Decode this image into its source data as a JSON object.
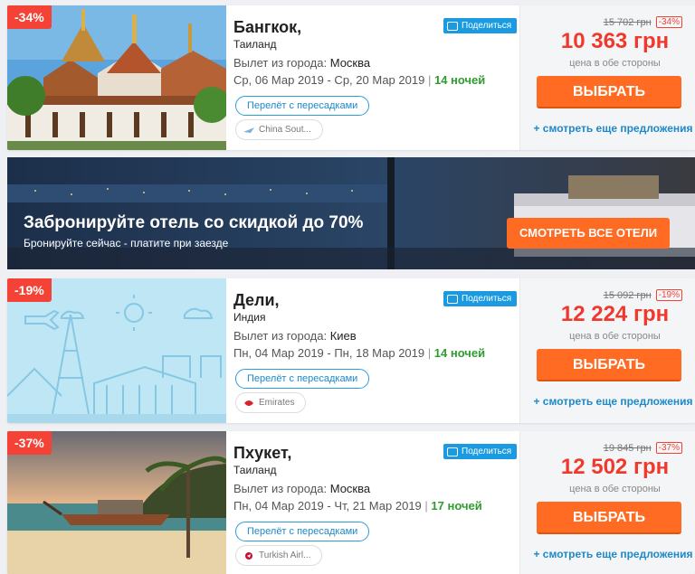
{
  "offers": [
    {
      "discount": "-34%",
      "city": "Бангкок,",
      "country": "Таиланд",
      "share_label": "Поделиться",
      "depart_label": "Вылет из города:",
      "depart_city": "Москва",
      "dates": "Ср, 06 Мар 2019 - Ср, 20 Мар 2019",
      "separator": "|",
      "nights": "14 ночей",
      "transfer": "Перелёт с пересадками",
      "airline": "China Sout...",
      "old_price": "15 702 грн",
      "old_pct": "-34%",
      "price": "10 363 грн",
      "price_note": "цена в обе стороны",
      "select_label": "ВЫБРАТЬ",
      "more_label": "+ смотреть еще предложения"
    },
    {
      "discount": "-19%",
      "city": "Дели,",
      "country": "Индия",
      "share_label": "Поделиться",
      "depart_label": "Вылет из города:",
      "depart_city": "Киев",
      "dates": "Пн, 04 Мар 2019 - Пн, 18 Мар 2019",
      "separator": "|",
      "nights": "14 ночей",
      "transfer": "Перелёт с пересадками",
      "airline": "Emirates",
      "old_price": "15 092 грн",
      "old_pct": "-19%",
      "price": "12 224 грн",
      "price_note": "цена в обе стороны",
      "select_label": "ВЫБРАТЬ",
      "more_label": "+ смотреть еще предложения"
    },
    {
      "discount": "-37%",
      "city": "Пхукет,",
      "country": "Таиланд",
      "share_label": "Поделиться",
      "depart_label": "Вылет из города:",
      "depart_city": "Москва",
      "dates": "Пн, 04 Мар 2019 - Чт, 21 Мар 2019",
      "separator": "|",
      "nights": "17 ночей",
      "transfer": "Перелёт с пересадками",
      "airline": "Turkish Airl...",
      "old_price": "19 845 грн",
      "old_pct": "-37%",
      "price": "12 502 грн",
      "price_note": "цена в обе стороны",
      "select_label": "ВЫБРАТЬ",
      "more_label": "+ смотреть еще предложения"
    }
  ],
  "banner": {
    "title": "Забронируйте отель со скидкой до 70%",
    "subtitle": "Бронируйте сейчас - платите при заезде",
    "button": "СМОТРЕТЬ ВСЕ ОТЕЛИ"
  },
  "colors": {
    "accent_orange": "#ff6b22",
    "price_red": "#f0382c",
    "badge_red": "#f44336",
    "link_blue": "#1e88c8",
    "nights_green": "#2e9c2e"
  }
}
